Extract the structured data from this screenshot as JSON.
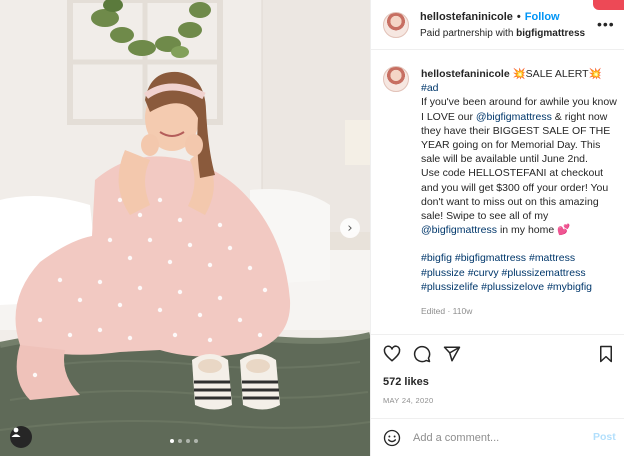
{
  "post": {
    "username": "hellostefaninicole",
    "follow_label": "Follow",
    "partnership_prefix": "Paid partnership with",
    "partner": "bigfigmattress",
    "more_glyph": "•••",
    "caption": {
      "username": "hellostefaninicole",
      "lead": "💥SALE ALERT💥",
      "tag_ad": "#ad",
      "text1": "If you've been around for awhile you know I LOVE our ",
      "mention1": "@bigfigmattress",
      "text2": " & right now they have their BIGGEST SALE OF THE YEAR going on for Memorial Day. This sale will be available until June 2nd.",
      "text3": "Use code HELLOSTEFANI at checkout and you will get $300 off your order! You don't want to miss out on this amazing sale! Swipe to see all of my ",
      "mention2": "@bigfigmattress",
      "text4": " in my home 💕",
      "hashtags": "#bigfig #bigfigmattress #mattress #plussize #curvy #plussizemattress #plussizelife #plussizelove #mybigfig",
      "meta": "Edited · 110w"
    },
    "likes": "572 likes",
    "date": "MAY 24, 2020",
    "comment_placeholder": "Add a comment...",
    "post_label": "Post",
    "next_arrow": "›",
    "carousel_count": 4,
    "carousel_active": 1
  },
  "colors": {
    "link_blue": "#0095f6",
    "mention": "#00376b",
    "post_disabled": "#b2dffc",
    "dress": "#f2c9c2",
    "blanket": "#5f6a58"
  },
  "icons": [
    "heart-icon",
    "comment-icon",
    "share-icon",
    "bookmark-icon",
    "emoji-icon",
    "user-tag-icon",
    "more-icon"
  ]
}
